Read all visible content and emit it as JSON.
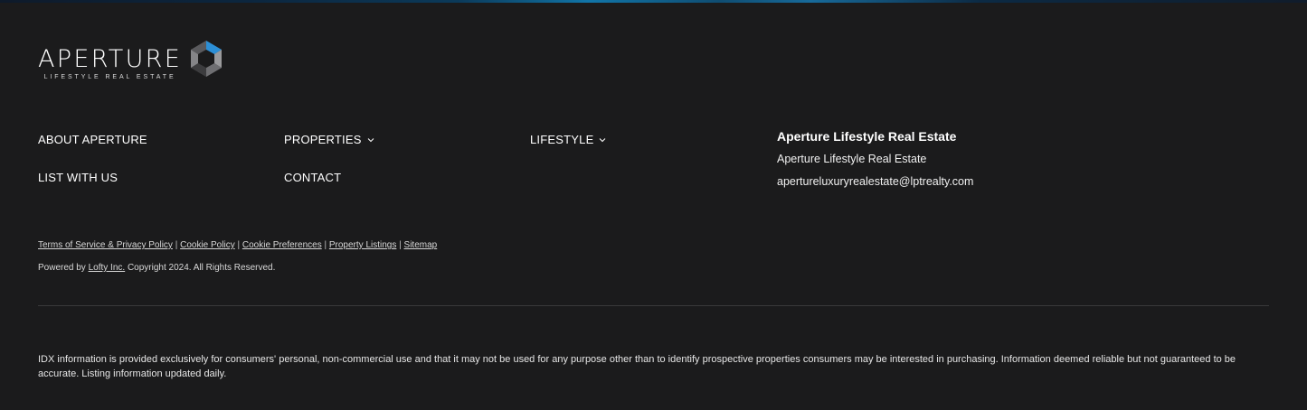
{
  "logo": {
    "word": "APERTURE",
    "tagline": "LIFESTYLE REAL ESTATE",
    "accent_color": "#2c8fd6"
  },
  "nav": {
    "about": "ABOUT APERTURE",
    "properties": "PROPERTIES",
    "lifestyle": "LIFESTYLE",
    "list_with_us": "LIST WITH US",
    "contact": "CONTACT"
  },
  "company": {
    "title": "Aperture Lifestyle Real Estate",
    "name": "Aperture Lifestyle Real Estate",
    "email": "apertureluxuryrealestate@lptrealty.com"
  },
  "legal": {
    "links": [
      "Terms of Service & Privacy Policy",
      "Cookie Policy",
      "Cookie Preferences",
      "Property Listings",
      "Sitemap"
    ],
    "separator": "|",
    "powered_prefix": "Powered by",
    "powered_link": "Lofty Inc.",
    "powered_suffix": "Copyright 2024. All Rights Reserved."
  },
  "disclaimer": "IDX information is provided exclusively for consumers' personal, non-commercial use and that it may not be used for any purpose other than to identify prospective properties consumers may be interested in purchasing. Information deemed reliable but not guaranteed to be accurate. Listing information updated daily.",
  "colors": {
    "background": "#1b1b1c",
    "text": "#ffffff",
    "divider": "#3a3a3b"
  }
}
